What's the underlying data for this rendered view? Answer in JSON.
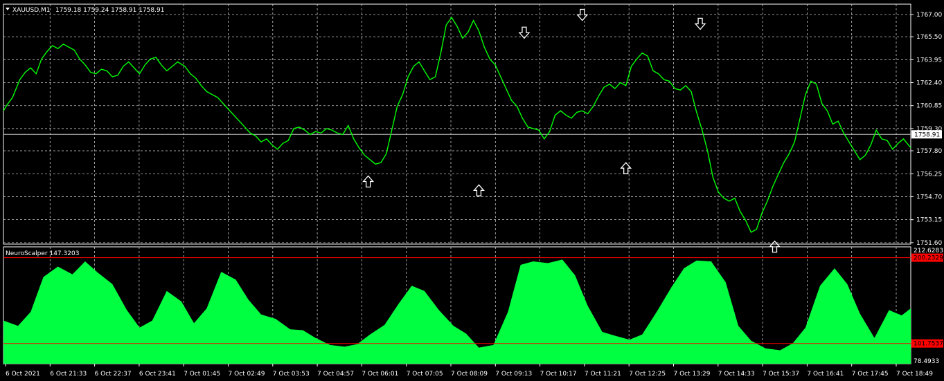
{
  "colors": {
    "background": "#000000",
    "foreground": "#ffffff",
    "grid": "#c8c8c8",
    "price_line": "#00ff00",
    "indicator_fill": "#00ff40",
    "level_line": "#ff0000",
    "current_price_line": "#c0c0c0",
    "arrow": "#ffffff"
  },
  "header": {
    "symbol_label": "XAUUSD,M1",
    "ohlc_text": "1759.18 1759.24 1758.91 1758.91",
    "menu_icon": "triangle-down-icon"
  },
  "indicator": {
    "title_text": "NeuroScalper 147.3203"
  },
  "chart_data": [
    {
      "type": "line",
      "name": "price-pane",
      "x_ticks": [
        "6 Oct 2021",
        "6 Oct 21:33",
        "6 Oct 22:37",
        "6 Oct 23:41",
        "7 Oct 01:45",
        "7 Oct 02:49",
        "7 Oct 03:53",
        "7 Oct 04:57",
        "7 Oct 06:01",
        "7 Oct 07:05",
        "7 Oct 08:09",
        "7 Oct 09:13",
        "7 Oct 10:17",
        "7 Oct 11:21",
        "7 Oct 12:25",
        "7 Oct 13:29",
        "7 Oct 14:33",
        "7 Oct 15:37",
        "7 Oct 16:41",
        "7 Oct 17:45",
        "7 Oct 18:49"
      ],
      "y_ticks": [
        "1767.00",
        "1765.50",
        "1763.95",
        "1762.40",
        "1760.85",
        "1759.30",
        "1757.80",
        "1756.25",
        "1754.70",
        "1753.15",
        "1751.60"
      ],
      "ylim": [
        1751.5,
        1767.7
      ],
      "current_price": 1758.91,
      "current_price_label": "1758.91",
      "x": [
        0,
        0.02,
        0.05,
        0.07,
        0.09,
        0.12,
        0.15,
        0.18,
        0.21,
        0.24,
        0.27,
        0.3,
        0.33,
        0.36,
        0.39,
        0.42,
        0.45,
        0.48,
        0.51,
        0.54,
        0.57,
        0.6,
        0.63,
        0.66,
        0.69,
        0.72,
        0.75,
        0.78,
        0.81,
        0.84,
        0.87,
        0.9,
        0.93,
        0.96,
        1.0,
        1.03,
        1.06,
        1.09,
        1.12,
        1.15,
        1.18,
        1.21,
        1.24,
        1.27,
        1.3,
        1.33,
        1.36,
        1.39,
        1.42,
        1.45,
        1.48,
        1.51,
        1.54,
        1.57,
        1.6,
        1.63,
        1.66,
        1.69,
        1.72,
        1.75,
        1.78,
        1.81,
        1.84,
        1.87,
        1.9,
        1.93,
        1.96,
        1.99,
        2.02,
        2.05,
        2.08,
        2.11,
        2.14,
        2.17,
        2.2,
        2.23,
        2.26,
        2.29,
        2.32,
        2.35,
        2.38,
        2.41,
        2.44,
        2.47,
        2.5,
        2.53,
        2.56,
        2.59,
        2.62,
        2.65,
        2.68,
        2.71,
        2.74,
        2.77,
        2.8,
        2.83,
        2.86,
        2.89,
        2.92,
        2.95,
        2.98,
        3.01,
        3.04,
        3.07,
        3.1,
        3.13,
        3.16,
        3.19,
        3.22,
        3.25,
        3.28,
        3.31,
        3.34,
        3.37,
        3.4,
        3.43,
        3.46,
        3.49,
        3.52,
        3.55,
        3.58,
        3.61,
        3.64,
        3.67,
        3.7,
        3.73,
        3.76,
        3.79,
        3.82,
        3.85,
        3.88,
        3.91,
        3.94,
        3.97,
        4.0,
        4.03,
        4.06,
        4.09,
        4.12,
        4.15,
        4.18,
        4.21,
        4.24,
        4.27,
        4.3,
        4.33,
        4.36,
        4.39,
        4.42,
        4.45,
        4.48,
        4.51,
        4.54,
        4.57,
        4.6,
        4.63,
        4.66,
        4.69,
        4.72,
        4.75,
        4.78,
        4.81,
        4.84,
        4.87,
        4.9,
        4.93,
        4.96,
        5.0
      ],
      "values": [
        1760.5,
        1760.9,
        1761.4,
        1762.0,
        1762.6,
        1763.1,
        1763.4,
        1763.0,
        1764.0,
        1764.5,
        1764.9,
        1764.7,
        1765.0,
        1764.8,
        1764.6,
        1764.0,
        1763.6,
        1763.1,
        1763.0,
        1763.3,
        1763.2,
        1762.8,
        1762.9,
        1763.5,
        1763.8,
        1763.4,
        1763.0,
        1763.6,
        1764.0,
        1764.1,
        1763.6,
        1763.2,
        1763.5,
        1763.8,
        1763.5,
        1763.0,
        1762.7,
        1762.2,
        1761.8,
        1761.6,
        1761.4,
        1761.0,
        1760.6,
        1760.2,
        1759.8,
        1759.4,
        1759.0,
        1758.8,
        1758.4,
        1758.6,
        1758.2,
        1757.9,
        1758.3,
        1758.5,
        1759.3,
        1759.4,
        1759.2,
        1758.9,
        1759.1,
        1759.0,
        1759.3,
        1759.2,
        1759.0,
        1758.9,
        1759.5,
        1758.6,
        1758.0,
        1757.5,
        1757.2,
        1756.9,
        1757.0,
        1757.6,
        1759.2,
        1760.8,
        1761.6,
        1762.8,
        1763.5,
        1763.8,
        1763.2,
        1762.6,
        1762.8,
        1764.4,
        1766.3,
        1766.8,
        1766.2,
        1765.4,
        1765.8,
        1766.6,
        1765.9,
        1764.8,
        1764.0,
        1763.6,
        1762.8,
        1762.0,
        1761.2,
        1760.8,
        1760.0,
        1759.4,
        1759.3,
        1759.2,
        1758.6,
        1759.1,
        1760.2,
        1760.5,
        1760.2,
        1760.0,
        1760.4,
        1760.5,
        1760.3,
        1760.8,
        1761.5,
        1762.1,
        1762.3,
        1762.0,
        1762.4,
        1762.2,
        1763.5,
        1764.0,
        1764.4,
        1764.2,
        1763.2,
        1763.0,
        1762.6,
        1762.5,
        1762.0,
        1761.9,
        1762.2,
        1761.8,
        1760.4,
        1759.2,
        1757.8,
        1756.0,
        1755.0,
        1754.6,
        1754.4,
        1754.6,
        1753.7,
        1753.1,
        1752.3,
        1752.5,
        1753.6,
        1754.4,
        1755.4,
        1756.2,
        1757.0,
        1757.6,
        1758.4,
        1760.0,
        1761.6,
        1762.5,
        1762.3,
        1761.0,
        1760.5,
        1759.6,
        1759.8,
        1759.0,
        1758.4,
        1757.8,
        1757.2,
        1757.5,
        1758.2,
        1759.2,
        1758.6,
        1758.5,
        1757.9,
        1758.3,
        1758.6,
        1758.0,
        1758.4,
        1759.1
      ],
      "arrows_up_at": [
        {
          "x": 2.01,
          "y": 1756.1
        },
        {
          "x": 2.62,
          "y": 1755.5
        },
        {
          "x": 3.43,
          "y": 1757.0
        },
        {
          "x": 4.25,
          "y": 1751.7
        }
      ],
      "arrows_down_at": [
        {
          "x": 2.87,
          "y": 1765.4
        },
        {
          "x": 3.19,
          "y": 1766.6
        },
        {
          "x": 3.84,
          "y": 1766.0
        }
      ]
    },
    {
      "type": "area",
      "name": "NeuroScalper",
      "y_ticks": [
        "212.6283",
        "200.2329",
        "101.7537",
        "78.4933"
      ],
      "ylim": [
        78.4933,
        212.6283
      ],
      "levels": [
        200.2329,
        101.7537
      ],
      "x": [
        0,
        0.08,
        0.15,
        0.22,
        0.3,
        0.38,
        0.45,
        0.52,
        0.6,
        0.68,
        0.75,
        0.82,
        0.9,
        0.98,
        1.05,
        1.12,
        1.2,
        1.28,
        1.35,
        1.42,
        1.5,
        1.58,
        1.65,
        1.72,
        1.8,
        1.88,
        1.95,
        2.02,
        2.1,
        2.18,
        2.25,
        2.32,
        2.4,
        2.48,
        2.55,
        2.62,
        2.7,
        2.78,
        2.85,
        2.92,
        3.0,
        3.08,
        3.15,
        3.22,
        3.3,
        3.38,
        3.45,
        3.52,
        3.6,
        3.68,
        3.75,
        3.82,
        3.9,
        3.98,
        4.05,
        4.12,
        4.2,
        4.28,
        4.35,
        4.42,
        4.5,
        4.58,
        4.65,
        4.72,
        4.8,
        4.88,
        4.95,
        5.0
      ],
      "values": [
        128,
        122,
        138,
        178,
        190,
        181,
        196,
        183,
        170,
        140,
        120,
        128,
        162,
        150,
        125,
        142,
        184,
        175,
        152,
        135,
        130,
        118,
        117,
        108,
        100,
        98,
        101,
        112,
        123,
        148,
        168,
        162,
        140,
        122,
        113,
        97,
        100,
        138,
        192,
        196,
        194,
        198,
        180,
        145,
        115,
        110,
        106,
        112,
        138,
        166,
        188,
        197,
        196,
        172,
        122,
        105,
        96,
        94,
        102,
        120,
        168,
        188,
        170,
        136,
        108,
        140,
        134,
        142
      ]
    }
  ]
}
